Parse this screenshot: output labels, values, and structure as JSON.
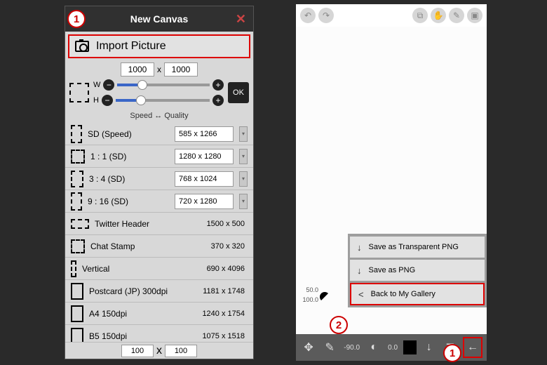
{
  "left": {
    "title": "New Canvas",
    "close_glyph": "✕",
    "import_label": "Import Picture",
    "dim_w": "1000",
    "dim_x": "x",
    "dim_h": "1000",
    "w_label": "W",
    "h_label": "H",
    "ok_label": "OK",
    "minus_glyph": "−",
    "plus_glyph": "+",
    "sq_label": "Speed ↔ Quality",
    "presets_editable": [
      {
        "label": "SD (Speed)",
        "value": "585 x 1266"
      },
      {
        "label": "1 : 1 (SD)",
        "value": "1280 x 1280"
      },
      {
        "label": "3 : 4 (SD)",
        "value": "768 x 1024"
      },
      {
        "label": "9 : 16 (SD)",
        "value": "720 x 1280"
      }
    ],
    "presets_fixed": [
      {
        "label": "Twitter Header",
        "value": "1500 x 500"
      },
      {
        "label": "Chat Stamp",
        "value": "370 x 320"
      },
      {
        "label": "Vertical",
        "value": "690 x 4096"
      },
      {
        "label": "Postcard (JP) 300dpi",
        "value": "1181 x 1748"
      },
      {
        "label": "A4 150dpi",
        "value": "1240 x 1754"
      },
      {
        "label": "B5 150dpi",
        "value": "1075 x 1518"
      }
    ],
    "bottom_w": "100",
    "bottom_h": "100"
  },
  "right": {
    "ruler_50": "50.0",
    "ruler_100": "100.0",
    "ruler_bottom_a": "-90.0",
    "ruler_bottom_b": "0.0",
    "menu": [
      {
        "icon": "↓",
        "label": "Save as Transparent PNG"
      },
      {
        "icon": "↓",
        "label": "Save as PNG"
      },
      {
        "icon": "<",
        "label": "Back to My Gallery"
      }
    ]
  },
  "badges": {
    "one": "1",
    "two": "2"
  }
}
